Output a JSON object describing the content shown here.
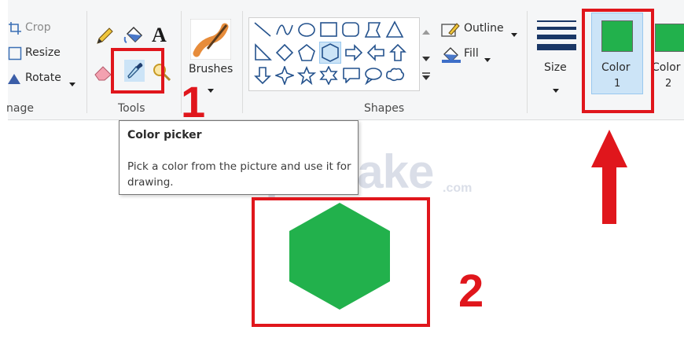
{
  "ribbon": {
    "image_group": {
      "label": "nage",
      "items": [
        {
          "label": "Crop",
          "icon": "crop-icon"
        },
        {
          "label": "Resize",
          "icon": "resize-icon"
        },
        {
          "label": "Rotate",
          "icon": "rotate-icon"
        }
      ]
    },
    "tools_group": {
      "label": "Tools",
      "tools": [
        "pencil-icon",
        "fill-bucket-icon",
        "text-icon",
        "eraser-icon",
        "color-picker-icon",
        "magnifier-icon"
      ]
    },
    "brushes": {
      "label": "Brushes",
      "icon": "brushes-icon"
    },
    "shapes_group": {
      "label": "Shapes",
      "outline_label": "Outline",
      "fill_label": "Fill"
    },
    "size": {
      "label": "Size"
    },
    "color1": {
      "label": "Color",
      "number": "1",
      "color": "#22b14c"
    },
    "color2": {
      "label": "Color",
      "number": "2",
      "color": "#22b14c"
    }
  },
  "tooltip": {
    "title": "Color picker",
    "body": "Pick a color from the picture and use it for drawing."
  },
  "canvas": {
    "shape": "hexagon",
    "fill_color": "#22b14c"
  },
  "annotations": {
    "number1": "1",
    "number2": "2",
    "arrow_color": "#e0161c"
  },
  "watermark": {
    "text": "TipsMake",
    "suffix": ".com"
  }
}
